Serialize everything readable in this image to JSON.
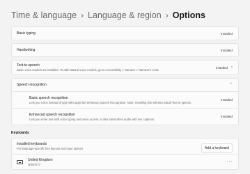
{
  "breadcrumb": {
    "items": [
      "Time & language",
      "Language & region",
      "Options"
    ],
    "separator": "›"
  },
  "basic_typing": {
    "title": "Basic typing",
    "status": "Installed"
  },
  "handwriting": {
    "title": "Handwriting",
    "status": "Installed"
  },
  "text_to_speech": {
    "title": "Text-to-speech",
    "description": "Basic voice models are installed. To add Natural voice models, go to Accessibility > Narrator > Narrator's voice",
    "status": "Installed",
    "chevron": "›"
  },
  "speech_recognition": {
    "title": "Speech recognition",
    "chevron": "⌃",
    "basic": {
      "title": "Basic speech recognition",
      "description": "Lets you voice instead of type with apps like Windows Speech Recognition. Note: Installing this will also install Text-to-speech.",
      "status": "Installed"
    },
    "enhanced": {
      "title": "Enhanced speech recognition",
      "description": "Lets you enter text with voice typing and voice access. It also transcribes audio with live captions.",
      "status": "Installed"
    }
  },
  "keyboards": {
    "section_label": "Keyboards",
    "installed": {
      "title": "Installed keyboards",
      "description": "For language-specific key layouts and input options",
      "add_button": "Add a keyboard"
    },
    "item": {
      "name": "United Kingdom",
      "subtitle": "QWERTY",
      "more": "···"
    }
  }
}
